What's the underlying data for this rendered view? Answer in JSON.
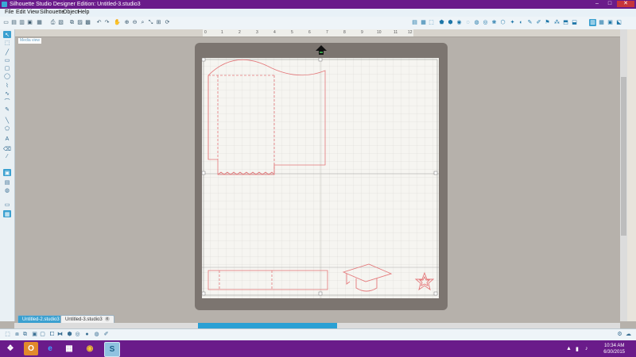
{
  "window": {
    "title": "Silhouette Studio Designer Edition: Untitled-3.studio3",
    "minimize": "–",
    "maximize": "□",
    "close": "✕"
  },
  "menu": [
    "File",
    "Edit",
    "View",
    "Silhouette",
    "Object",
    "Help"
  ],
  "ruler": {
    "ticks": [
      "0",
      "1",
      "2",
      "3",
      "4",
      "5",
      "6",
      "7",
      "8",
      "9",
      "10",
      "11",
      "12"
    ]
  },
  "canvas": {
    "view_label": "Media view"
  },
  "tabs": [
    {
      "label": "Untitled-2.studio3",
      "active": true
    },
    {
      "label": "Untitled-3.studio3",
      "active": false
    }
  ],
  "tab_close_glyph": "x",
  "taskbar": {
    "time": "10:34 AM",
    "date": "6/30/2015"
  },
  "colors": {
    "title_bar": "#6a1b8a",
    "accent": "#3aa0d0",
    "cut_line": "#e4787a",
    "mat": "#7c7570"
  }
}
